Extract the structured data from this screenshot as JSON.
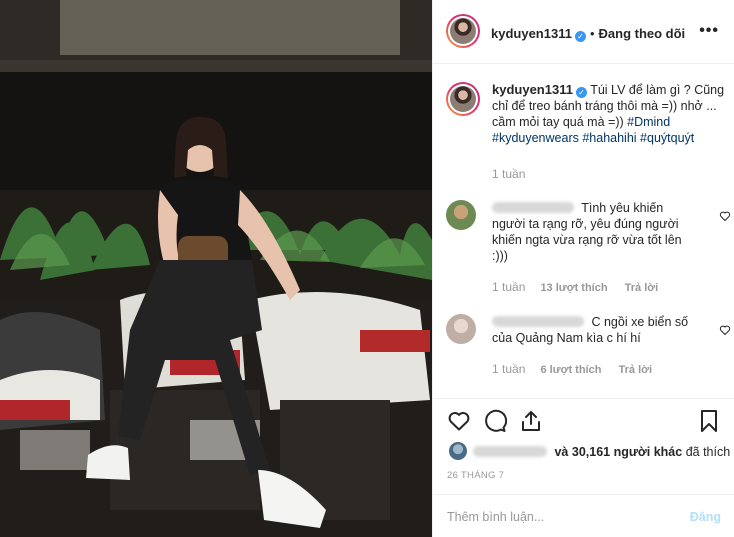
{
  "post": {
    "username": "kyduyen1311",
    "verified_mark": "✓",
    "dot": "•",
    "follow_status": "Đang theo dõi",
    "more_glyph": "•••"
  },
  "caption": {
    "username": "kyduyen1311",
    "text": "Túi LV để làm gì ? Cũng chỉ để treo bánh tráng thôi mà =)) nhở ... cầm mỏi tay quá mà =))",
    "hashtags": [
      "#Dmind",
      "#kyduyenwears",
      "#hahahihi",
      "#quýtquýt"
    ],
    "time": "1 tuần"
  },
  "comments": [
    {
      "text": "Tình yêu khiến người ta rạng rỡ, yêu đúng người khiến ngta vừa rạng rỡ vừa tốt lên :)))",
      "time": "1 tuần",
      "likes": "13 lượt thích",
      "reply": "Trả lời"
    },
    {
      "text": "C ngồi xe biển số của Quảng Nam kìa c hí hí",
      "time": "1 tuần",
      "likes": "6 lượt thích",
      "reply": "Trả lời"
    }
  ],
  "likes_summary": {
    "text": "và 30,161 người khác",
    "suffix": "đã thích"
  },
  "date": "26 THÁNG 7",
  "add_comment": {
    "placeholder": "Thêm bình luận...",
    "post_label": "Đăng"
  },
  "icons": {
    "like": "heart-icon",
    "comment": "comment-icon",
    "share": "share-icon",
    "save": "bookmark-icon"
  },
  "colors": {
    "verified": "#3897f0",
    "hashtag": "#003569",
    "muted": "#999999",
    "post_disabled": "#b2dffc"
  }
}
